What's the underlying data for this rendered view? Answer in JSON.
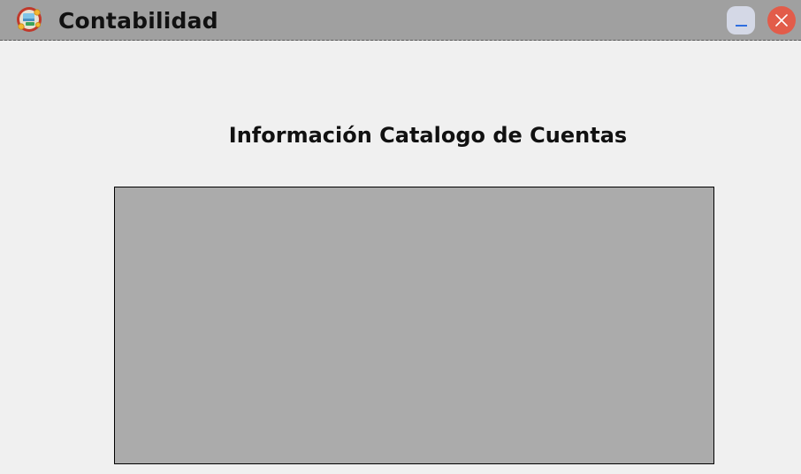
{
  "window": {
    "title": "Contabilidad",
    "icon": "accounting-app-icon",
    "titlebar_color": "#a0a0a0",
    "background_color": "#f0f0f0"
  },
  "controls": {
    "minimize_icon": "minimize-icon",
    "close_icon": "close-icon",
    "close_color": "#e25c4a"
  },
  "main": {
    "heading": "Información Catalogo de Cuentas",
    "grid_background": "#ababab"
  }
}
